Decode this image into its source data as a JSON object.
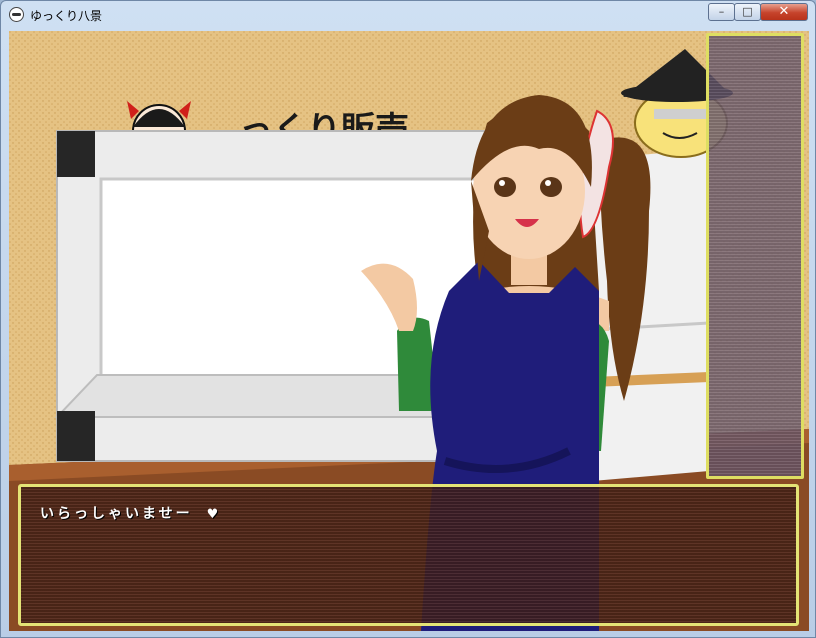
{
  "window": {
    "title": "ゆっくり八景",
    "minimize_label": "–",
    "maximize_label": "□",
    "close_label": "✕"
  },
  "sign": {
    "text": "っくり販売"
  },
  "dialog": {
    "text": "いらっしゃいませー",
    "cursor": "♥"
  },
  "colors": {
    "panel_border": "#e4e476",
    "apron": "#1f1d7a",
    "sleeve": "#2f8a3a",
    "hair": "#6b3d16"
  },
  "icons": [
    "app-icon",
    "minimize-icon",
    "maximize-icon",
    "close-icon",
    "heart-cursor-icon"
  ]
}
